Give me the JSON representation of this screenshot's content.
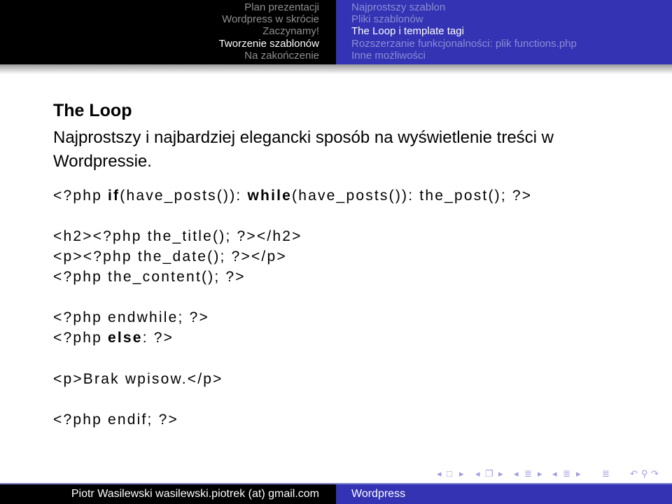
{
  "header": {
    "sections": [
      {
        "label": "Plan prezentacji",
        "active": false
      },
      {
        "label": "Wordpress w skrócie",
        "active": false
      },
      {
        "label": "Zaczynamy!",
        "active": false
      },
      {
        "label": "Tworzenie szablonów",
        "active": true
      },
      {
        "label": "Na zakończenie",
        "active": false
      }
    ],
    "subsections": [
      {
        "label": "Najprostszy szablon",
        "active": false
      },
      {
        "label": "Pliki szablonów",
        "active": false
      },
      {
        "label": "The Loop i template tagi",
        "active": true
      },
      {
        "label": "Rozszerzanie funkcjonalności: plik functions.php",
        "active": false
      },
      {
        "label": "Inne możliwości",
        "active": false
      }
    ]
  },
  "frame": {
    "title": "The Loop",
    "intro": "Najprostszy i najbardziej elegancki sposób na wyświetlenie treści w Wordpressie."
  },
  "code": {
    "line1": {
      "a": "<?php ",
      "kw_if": "if",
      "b": "(have_posts()): ",
      "kw_while": "while",
      "c": "(have_posts()): the_post(); ?>"
    },
    "line2": "<h2><?php the_title(); ?></h2>",
    "line3": "<p><?php the_date(); ?></p>",
    "line4": "<?php the_content(); ?>",
    "line5": "<?php endwhile; ?>",
    "line6": {
      "a": "<?php ",
      "kw_else": "else",
      "b": ": ?>"
    },
    "line7": "<p>Brak wpisow.</p>",
    "line8": "<?php endif; ?>"
  },
  "nav_symbols": {
    "frame_prev": "◂",
    "frame_icon": "□",
    "frame_next": "▸",
    "sub_prev": "◂",
    "sub_icon": "❐",
    "sub_next": "▸",
    "sec_prev": "◂",
    "sec_icon": "≣",
    "sec_next": "▸",
    "subsec_prev": "◂",
    "subsec_icon": "≣",
    "subsec_next": "▸",
    "toc_icon": "≣",
    "back_icon": "↶",
    "search_icon": "⚲",
    "forward_icon": "↷"
  },
  "footer": {
    "author": "Piotr Wasilewski wasilewski.piotrek (at) gmail.com",
    "title": "Wordpress"
  },
  "colors": {
    "header_left": "#000000",
    "header_right": "#3333b3",
    "inactive_section": "#8f8f8f",
    "inactive_subsection": "#8d8dd6",
    "active": "#ffffff"
  }
}
